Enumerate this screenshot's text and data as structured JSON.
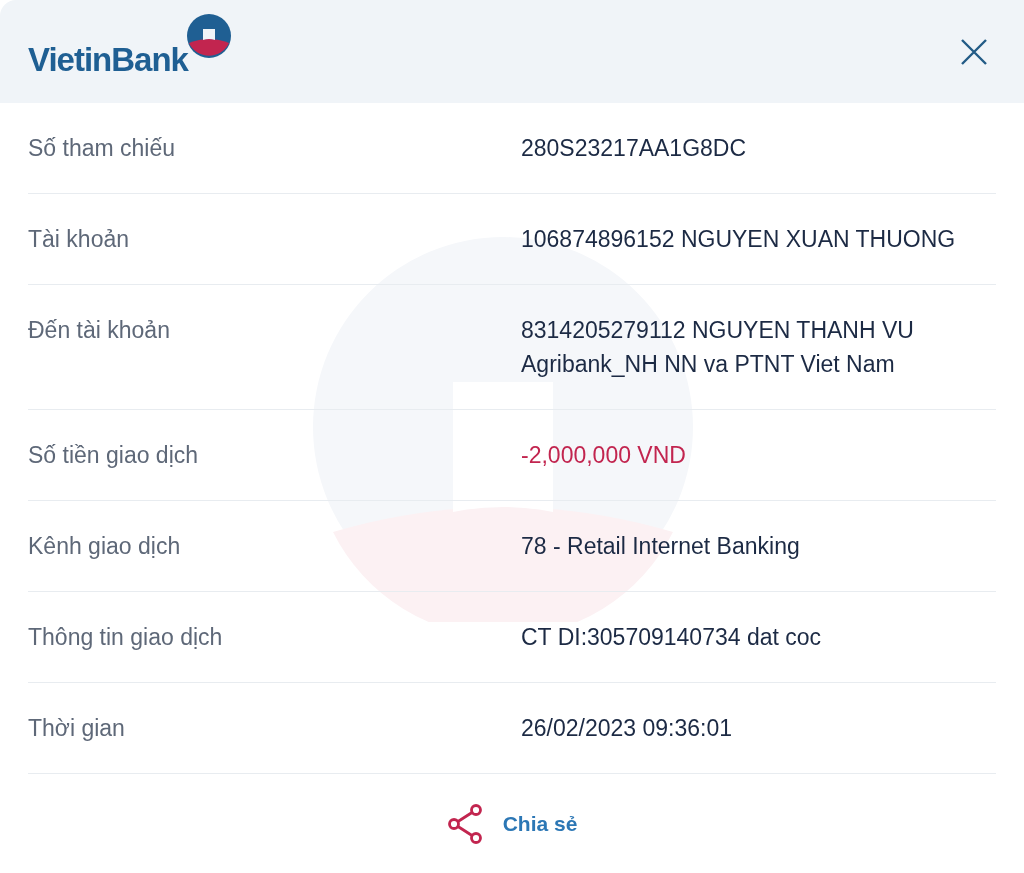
{
  "header": {
    "logo_text": "VietinBank"
  },
  "details": [
    {
      "label": "Số tham chiếu",
      "kind": "text",
      "value": [
        "280S23217AA1G8DC"
      ]
    },
    {
      "label": "Tài khoản",
      "kind": "text",
      "value": [
        "106874896152 NGUYEN XUAN THUONG"
      ]
    },
    {
      "label": "Đến tài khoản",
      "kind": "text",
      "value": [
        "8314205279112 NGUYEN THANH VU",
        "Agribank_NH NN va PTNT Viet Nam"
      ]
    },
    {
      "label": "Số tiền giao dịch",
      "kind": "amount",
      "value": [
        "-2,000,000 VND"
      ]
    },
    {
      "label": "Kênh giao dịch",
      "kind": "text",
      "value": [
        "78 - Retail Internet Banking"
      ]
    },
    {
      "label": "Thông tin giao dịch",
      "kind": "text",
      "value": [
        "CT DI:305709140734 dat coc"
      ]
    },
    {
      "label": "Thời gian",
      "kind": "text",
      "value": [
        "26/02/2023 09:36:01"
      ]
    }
  ],
  "share_button": "Chia sẻ"
}
